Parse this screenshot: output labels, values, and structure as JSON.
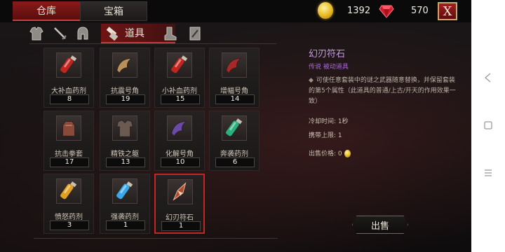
{
  "tabs": [
    {
      "label": "仓库",
      "active": true
    },
    {
      "label": "宝箱",
      "active": false
    }
  ],
  "currency": {
    "gold": "1392",
    "gems": "570"
  },
  "close_label": "X",
  "categories": [
    {
      "icon": "armor-icon"
    },
    {
      "icon": "sword-icon"
    },
    {
      "icon": "helmet-icon"
    },
    {
      "icon": "items-icon",
      "label": "道具",
      "active": true
    },
    {
      "icon": "boot-icon"
    },
    {
      "icon": "scroll-icon"
    }
  ],
  "items": [
    {
      "name": "大补血药剂",
      "qty": "8",
      "icon": "red-potion-icon",
      "color": "#c4241e"
    },
    {
      "name": "抗震号角",
      "qty": "19",
      "icon": "antler-horn-icon",
      "color": "#b89058"
    },
    {
      "name": "小补血药剂",
      "qty": "15",
      "icon": "red-potion-icon",
      "color": "#c4241e"
    },
    {
      "name": "增幅号角",
      "qty": "14",
      "icon": "red-horn-icon",
      "color": "#a82828"
    },
    {
      "name": "抗击拳套",
      "qty": "17",
      "icon": "gauntlet-icon",
      "color": "#8a4a3a"
    },
    {
      "name": "精铁之躯",
      "qty": "13",
      "icon": "iron-armor-icon",
      "color": "#6a5a50"
    },
    {
      "name": "化解号角",
      "qty": "10",
      "icon": "purple-horn-icon",
      "color": "#6a4aa8"
    },
    {
      "name": "奔袭药剂",
      "qty": "6",
      "icon": "green-potion-icon",
      "color": "#2ab080"
    },
    {
      "name": "愤怒药剂",
      "qty": "3",
      "icon": "orange-potion-icon",
      "color": "#e0a020"
    },
    {
      "name": "强袭药剂",
      "qty": "1",
      "icon": "blue-potion-icon",
      "color": "#3aa8e8"
    },
    {
      "name": "幻刃符石",
      "qty": "1",
      "icon": "blade-rune-icon",
      "color": "#b04a2a",
      "selected": true
    }
  ],
  "detail": {
    "title": "幻刃符石",
    "subtitle": "传说 被动道具",
    "bullet": "◆",
    "description": "可使任意套装中的谜之武器随意替换，并保留套装的第5个属性（此道具的普通/上古/开天的作用效果一致）",
    "cooldown": "冷却时间: 1秒",
    "carry_limit": "携带上限: 1",
    "sell_price_label": "出售价格: 0",
    "sell_button": "出售"
  },
  "colors": {
    "accent_red": "#8a1a1a",
    "legend_purple": "#c69ce8",
    "selected_border": "#c02828"
  }
}
